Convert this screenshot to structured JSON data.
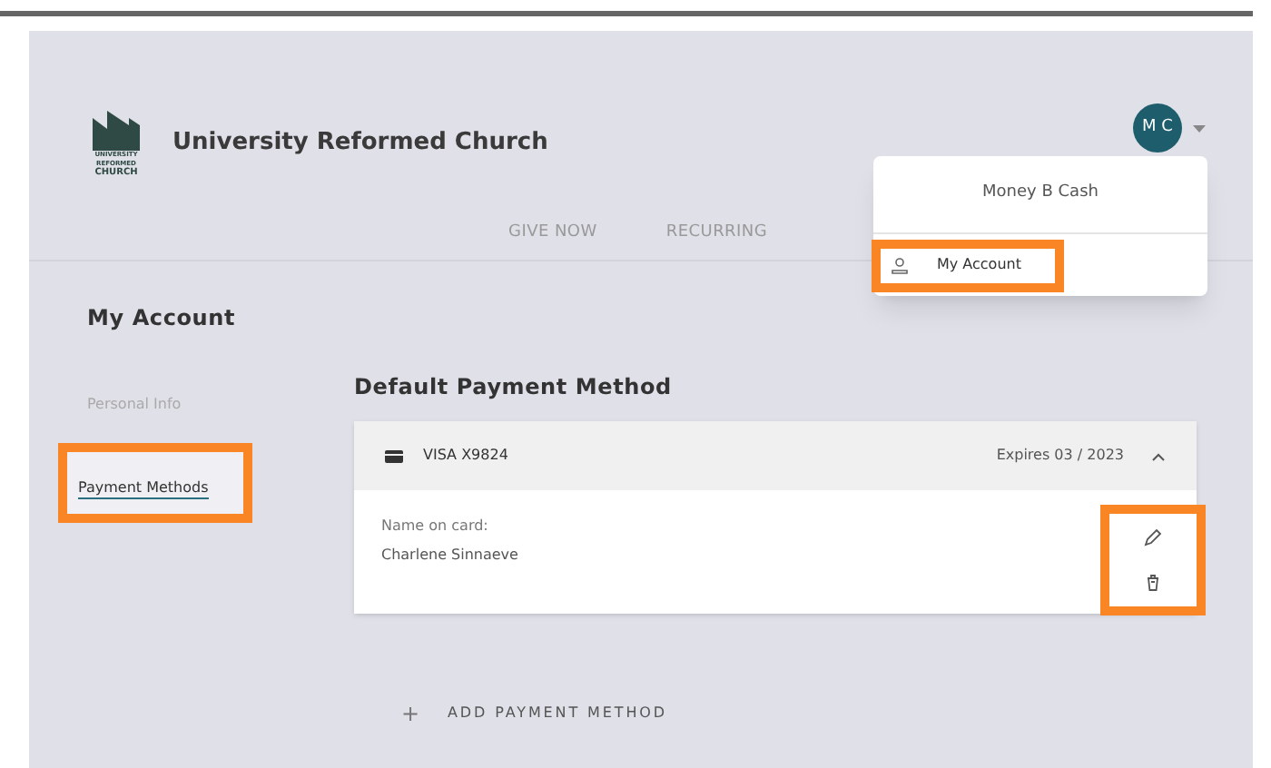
{
  "header": {
    "org_name": "University Reformed Church",
    "logo_text": [
      "UNIVERSITY",
      "REFORMED",
      "CHURCH"
    ],
    "avatar_initials": "M C"
  },
  "nav": [
    {
      "label": "GIVE NOW"
    },
    {
      "label": "RECURRING"
    }
  ],
  "user_menu": {
    "name": "Money B Cash",
    "items": [
      {
        "label": "My Account",
        "highlighted": true
      }
    ]
  },
  "sidebar": {
    "title": "My Account",
    "items": [
      {
        "label": "Personal Info",
        "selected": false,
        "highlighted": false
      },
      {
        "label": "Payment Methods",
        "selected": true,
        "highlighted": true
      }
    ]
  },
  "payment": {
    "title": "Default Payment Method",
    "card": {
      "label": "VISA X9824",
      "expires": "Expires 03 / 2023",
      "expanded": true,
      "name_label": "Name on card:",
      "name": "Charlene Sinnaeve",
      "actions_highlighted": true
    },
    "add_label": "ADD PAYMENT METHOD",
    "add_icon": "+"
  }
}
